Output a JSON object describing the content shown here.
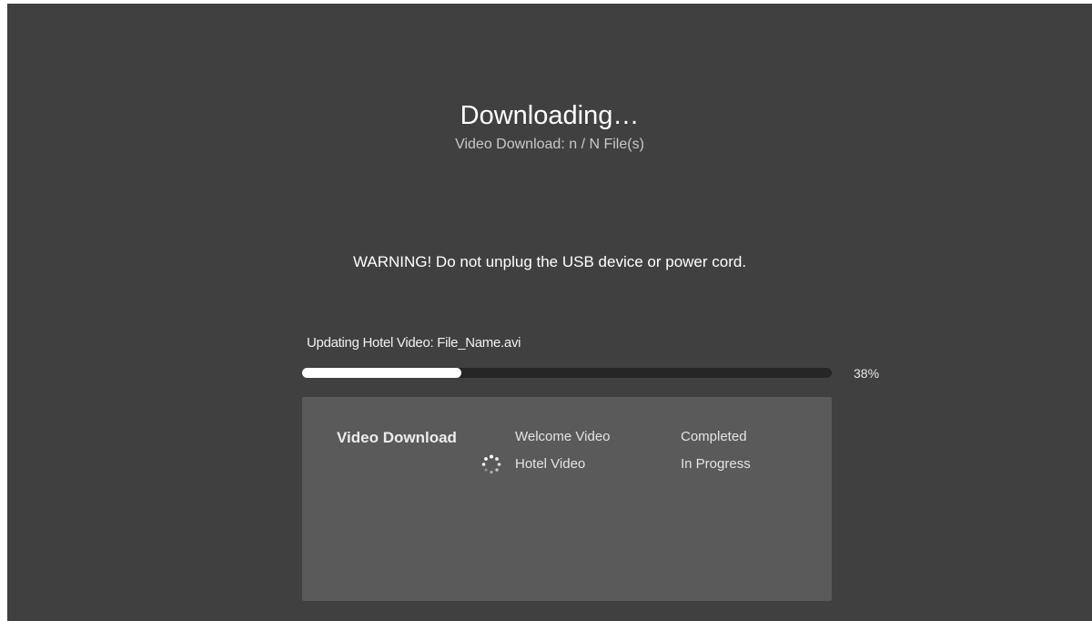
{
  "header": {
    "title": "Downloading…",
    "subtitle": "Video Download: n / N File(s)"
  },
  "warning": "WARNING! Do not unplug the USB device or power cord.",
  "progress": {
    "label": "Updating Hotel Video: File_Name.avi",
    "value": 0.3,
    "percent_text": "38%"
  },
  "panel": {
    "heading": "Video Download",
    "items": [
      {
        "name": "Welcome Video",
        "status": "Completed",
        "icon": ""
      },
      {
        "name": "Hotel Video",
        "status": "In Progress",
        "icon": "loading-spinner-icon"
      }
    ]
  },
  "colors": {
    "background": "#404040",
    "panel": "#5a5a5a",
    "track": "#262626",
    "fill": "#ffffff"
  }
}
